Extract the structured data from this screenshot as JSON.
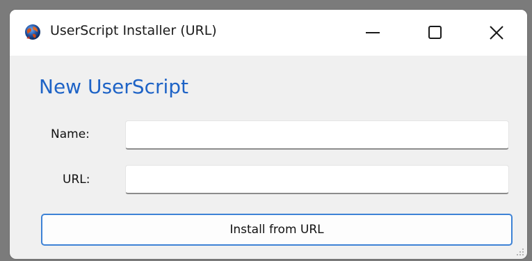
{
  "window": {
    "title": "UserScript Installer (URL)",
    "app_icon": "globe-icon",
    "controls": {
      "minimize_icon": "minimize-icon",
      "maximize_icon": "maximize-icon",
      "close_icon": "close-icon"
    }
  },
  "form": {
    "heading": "New UserScript",
    "name_label": "Name:",
    "name_value": "",
    "url_label": "URL:",
    "url_value": "",
    "install_button_label": "Install from URL"
  },
  "colors": {
    "heading": "#1e63c6",
    "button_border": "#3d82d6",
    "window_bg": "#f0f0f0",
    "titlebar_bg": "#ffffff"
  }
}
